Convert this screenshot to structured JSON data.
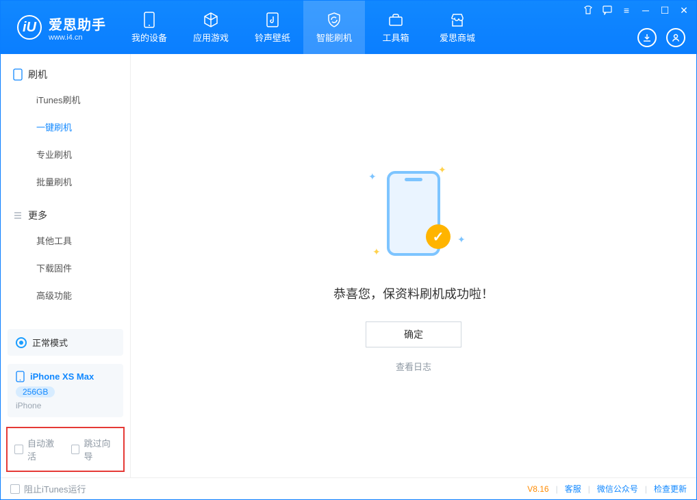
{
  "app": {
    "title": "爱思助手",
    "url": "www.i4.cn"
  },
  "nav": {
    "items": [
      {
        "label": "我的设备"
      },
      {
        "label": "应用游戏"
      },
      {
        "label": "铃声壁纸"
      },
      {
        "label": "智能刷机"
      },
      {
        "label": "工具箱"
      },
      {
        "label": "爱思商城"
      }
    ]
  },
  "sidebar": {
    "section1": {
      "title": "刷机",
      "items": [
        "iTunes刷机",
        "一键刷机",
        "专业刷机",
        "批量刷机"
      ]
    },
    "section2": {
      "title": "更多",
      "items": [
        "其他工具",
        "下载固件",
        "高级功能"
      ]
    },
    "mode_label": "正常模式",
    "device": {
      "name": "iPhone XS Max",
      "storage": "256GB",
      "type": "iPhone"
    },
    "checks": {
      "auto_activate": "自动激活",
      "skip_guide": "跳过向导"
    }
  },
  "main": {
    "success_text": "恭喜您，保资料刷机成功啦！",
    "ok_button": "确定",
    "view_log": "查看日志"
  },
  "footer": {
    "block_itunes": "阻止iTunes运行",
    "version": "V8.16",
    "support": "客服",
    "wechat": "微信公众号",
    "update": "检查更新"
  }
}
